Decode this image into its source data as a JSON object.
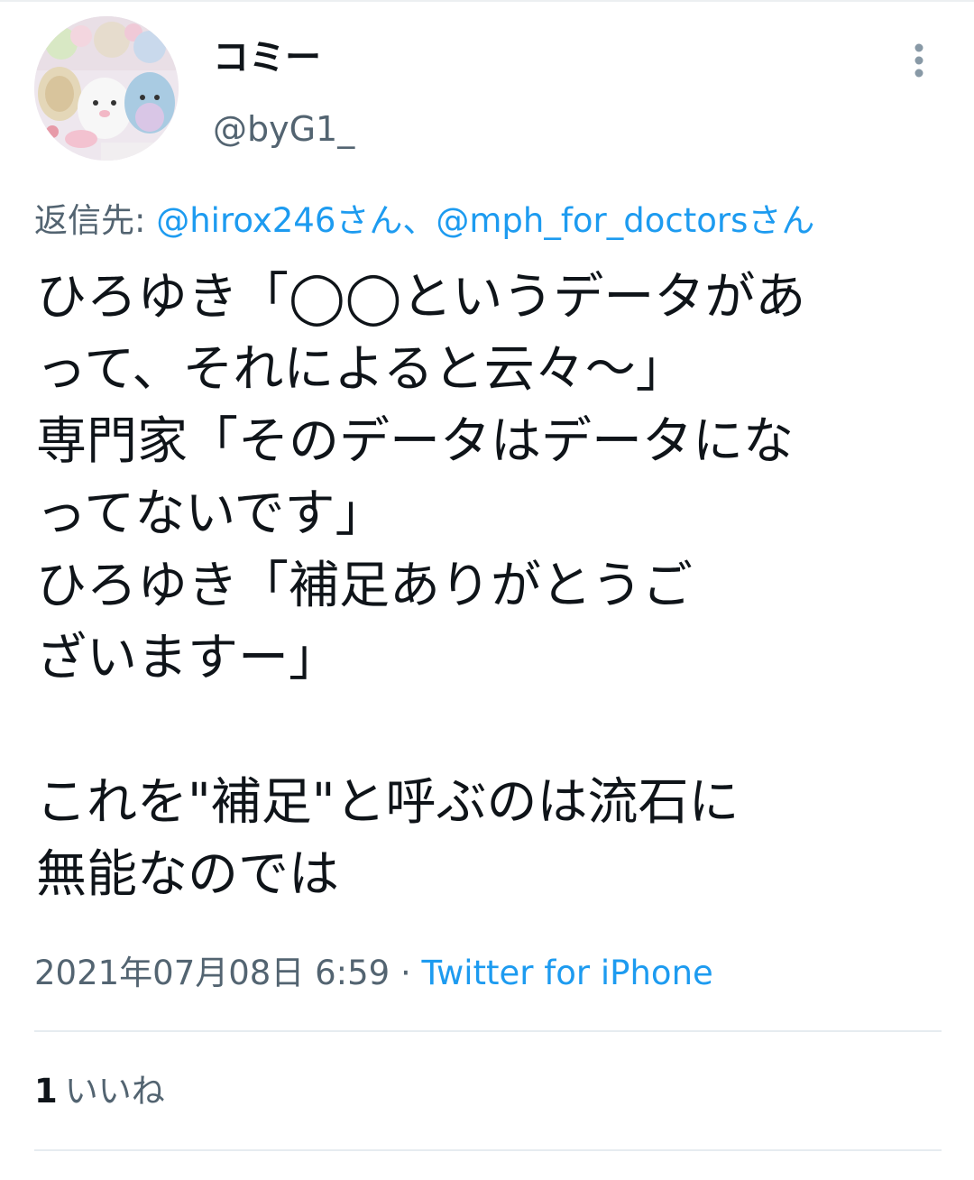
{
  "author": {
    "display_name": "コミー",
    "handle": "@byG1_"
  },
  "reply": {
    "prefix": "返信先: ",
    "mention_1": "@hirox246さん",
    "separator": "、",
    "mention_2": "@mph_for_doctorsさん"
  },
  "tweet": {
    "lines": [
      "ひろゆき「◯◯というデータがあ",
      "って、それによると云々〜」",
      "専門家「そのデータはデータにな",
      "ってないです」",
      "ひろゆき「補足ありがとうご",
      "ざいますー」",
      "",
      "これを\"補足\"と呼ぶのは流石に",
      "無能なのでは"
    ]
  },
  "meta": {
    "timestamp": "2021年07月08日 6:59",
    "dot": " · ",
    "source": "Twitter for iPhone"
  },
  "stats": {
    "likes_count": "1",
    "likes_label": "いいね"
  },
  "icons": {
    "more": "more-vertical-icon",
    "avatar": "avatar-image"
  },
  "colors": {
    "text": "#0f1419",
    "secondary": "#536471",
    "link": "#1d9bf0"
  }
}
